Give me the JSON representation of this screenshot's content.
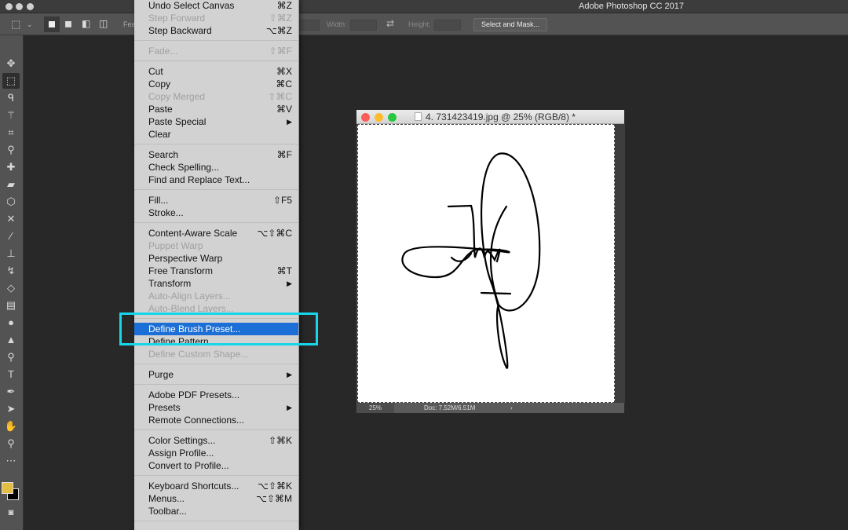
{
  "app_title": "Adobe Photoshop CC 2017",
  "options": {
    "feather_label_partial": "Fea",
    "width_label": "Width:",
    "height_label": "Height:",
    "select_mask": "Select and Mask..."
  },
  "document": {
    "title": "4. 731423419.jpg @ 25% (RGB/8) *",
    "zoom": "25%",
    "doc_size": "Doc: 7.52M/6.51M",
    "status_arrow": "›"
  },
  "colors": {
    "foreground": "#e6bd43",
    "background": "#000000",
    "highlight": "#1b6fd6",
    "callout": "#17d6ea"
  },
  "tools": [
    "move",
    "rectangular-marquee",
    "lasso",
    "magic-wand",
    "crop",
    "eyedropper",
    "spot-healing",
    "healing-brush",
    "patch",
    "content-aware-move",
    "brush",
    "clone-stamp",
    "history-brush",
    "eraser",
    "gradient",
    "blur",
    "sharpen",
    "dodge",
    "type",
    "pen",
    "path-selection",
    "hand",
    "zoom",
    "more"
  ],
  "menu": [
    {
      "label": "Undo Select Canvas",
      "shortcut": "⌘Z"
    },
    {
      "label": "Step Forward",
      "shortcut": "⇧⌘Z",
      "disabled": true
    },
    {
      "label": "Step Backward",
      "shortcut": "⌥⌘Z"
    },
    {
      "sep": true
    },
    {
      "label": "Fade...",
      "shortcut": "⇧⌘F",
      "disabled": true
    },
    {
      "sep": true
    },
    {
      "label": "Cut",
      "shortcut": "⌘X"
    },
    {
      "label": "Copy",
      "shortcut": "⌘C"
    },
    {
      "label": "Copy Merged",
      "shortcut": "⇧⌘C",
      "disabled": true
    },
    {
      "label": "Paste",
      "shortcut": "⌘V"
    },
    {
      "label": "Paste Special",
      "shortcut": "▶"
    },
    {
      "label": "Clear",
      "shortcut": ""
    },
    {
      "sep": true
    },
    {
      "label": "Search",
      "shortcut": "⌘F"
    },
    {
      "label": "Check Spelling...",
      "shortcut": ""
    },
    {
      "label": "Find and Replace Text...",
      "shortcut": ""
    },
    {
      "sep": true
    },
    {
      "label": "Fill...",
      "shortcut": "⇧F5"
    },
    {
      "label": "Stroke...",
      "shortcut": ""
    },
    {
      "sep": true
    },
    {
      "label": "Content-Aware Scale",
      "shortcut": "⌥⇧⌘C"
    },
    {
      "label": "Puppet Warp",
      "shortcut": "",
      "disabled": true
    },
    {
      "label": "Perspective Warp",
      "shortcut": ""
    },
    {
      "label": "Free Transform",
      "shortcut": "⌘T"
    },
    {
      "label": "Transform",
      "shortcut": "▶"
    },
    {
      "label": "Auto-Align Layers...",
      "shortcut": "",
      "disabled": true
    },
    {
      "label": "Auto-Blend Layers...",
      "shortcut": "",
      "disabled": true
    },
    {
      "sep": true
    },
    {
      "label": "Define Brush Preset...",
      "shortcut": "",
      "highlighted": true
    },
    {
      "label": "Define Pattern...",
      "shortcut": ""
    },
    {
      "label": "Define Custom Shape...",
      "shortcut": "",
      "disabled": true
    },
    {
      "sep": true
    },
    {
      "label": "Purge",
      "shortcut": "▶"
    },
    {
      "sep": true
    },
    {
      "label": "Adobe PDF Presets...",
      "shortcut": ""
    },
    {
      "label": "Presets",
      "shortcut": "▶"
    },
    {
      "label": "Remote Connections...",
      "shortcut": ""
    },
    {
      "sep": true
    },
    {
      "label": "Color Settings...",
      "shortcut": "⇧⌘K"
    },
    {
      "label": "Assign Profile...",
      "shortcut": ""
    },
    {
      "label": "Convert to Profile...",
      "shortcut": ""
    },
    {
      "sep": true
    },
    {
      "label": "Keyboard Shortcuts...",
      "shortcut": "⌥⇧⌘K"
    },
    {
      "label": "Menus...",
      "shortcut": "⌥⇧⌘M"
    },
    {
      "label": "Toolbar...",
      "shortcut": ""
    },
    {
      "sep": true
    }
  ]
}
